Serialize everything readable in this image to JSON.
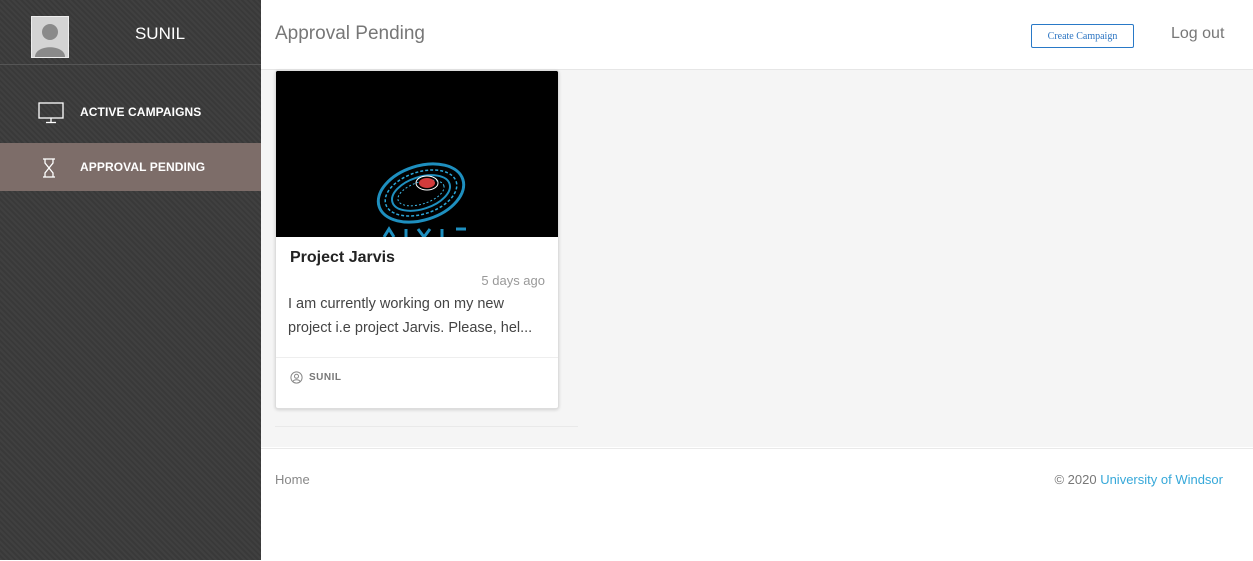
{
  "sidebar": {
    "user_name": "SUNIL",
    "items": [
      {
        "label": "ACTIVE CAMPAIGNS",
        "icon": "monitor-icon",
        "active": false
      },
      {
        "label": "APPROVAL PENDING",
        "icon": "hourglass-icon",
        "active": true
      }
    ]
  },
  "header": {
    "title": "Approval Pending",
    "create_label": "Create Campaign",
    "logout_label": "Log out"
  },
  "card": {
    "title": "Project Jarvis",
    "time": "5 days ago",
    "description": "I am currently working on my new project i.e project Jarvis. Please, hel...",
    "author": "SUNIL",
    "author_icon": "user-circle-icon"
  },
  "footer": {
    "home_label": "Home",
    "copyright_prefix": "© 2020 ",
    "copyright_link": "University of Windsor"
  },
  "colors": {
    "sidebar_bg": "#3b3b3b",
    "active_item": "#7d6d69",
    "accent_link": "#36a8d9",
    "button_border": "#2979c7"
  }
}
